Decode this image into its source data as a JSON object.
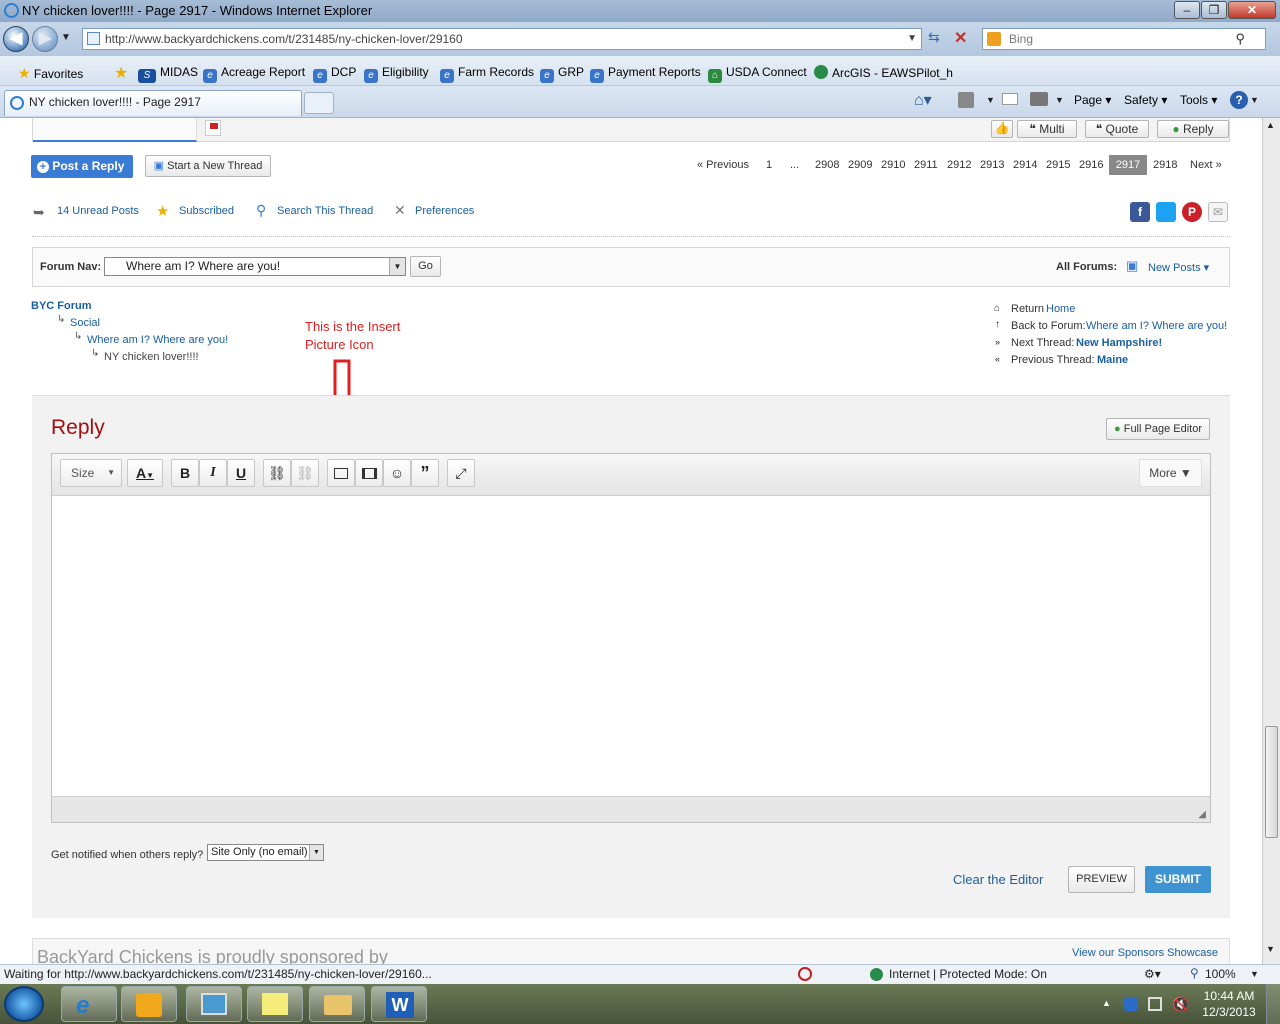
{
  "window": {
    "title": "NY chicken lover!!!! - Page 2917 - Windows Internet Explorer"
  },
  "address": {
    "url": "http://www.backyardchickens.com/t/231485/ny-chicken-lover/29160",
    "search_engine": "Bing"
  },
  "favorites": {
    "label": "Favorites",
    "items": [
      "MIDAS",
      "Acreage Report",
      "DCP",
      "Eligibility",
      "Farm Records",
      "GRP",
      "Payment Reports",
      "USDA Connect",
      "ArcGIS - EAWSPilot_h"
    ]
  },
  "tab": {
    "title": "NY chicken lover!!!! - Page 2917"
  },
  "commandbar": {
    "page": "Page",
    "safety": "Safety",
    "tools": "Tools"
  },
  "post_actions": {
    "multi": "Multi",
    "quote": "Quote",
    "reply": "Reply"
  },
  "thread_actions": {
    "post_reply": "Post a Reply",
    "new_thread": "Start a New Thread"
  },
  "pagination": {
    "previous": "« Previous",
    "first": "1",
    "ellipsis": "...",
    "pages": [
      "2908",
      "2909",
      "2910",
      "2911",
      "2912",
      "2913",
      "2914",
      "2915",
      "2916"
    ],
    "current": "2917",
    "after": "2918",
    "next": "Next »"
  },
  "tools_row": {
    "unread": "14 Unread Posts",
    "subscribed": "Subscribed",
    "search": "Search This Thread",
    "preferences": "Preferences"
  },
  "forum_nav": {
    "label": "Forum Nav:",
    "selected": "Where am I? Where are you!",
    "go": "Go",
    "all_forums": "All Forums:",
    "new_posts": "New Posts"
  },
  "breadcrumb": {
    "root": "BYC Forum",
    "level1": "Social",
    "level2": "Where am I? Where are you!",
    "level3": "NY chicken lover!!!!"
  },
  "annotation": {
    "line1": "This is the Insert",
    "line2": "Picture Icon",
    "color": "#e02020"
  },
  "thread_nav": {
    "return_label": "Return",
    "return_link": "Home",
    "back_label": "Back to Forum:",
    "back_link": "Where am I? Where are you!",
    "next_label": "Next Thread:",
    "next_link": "New Hampshire!",
    "prev_label": "Previous Thread:",
    "prev_link": "Maine"
  },
  "editor": {
    "heading": "Reply",
    "full_page": "Full Page Editor",
    "size": "Size",
    "more": "More"
  },
  "notify": {
    "label": "Get notified when others reply?",
    "selected": "Site Only (no email)"
  },
  "form_actions": {
    "clear": "Clear the Editor",
    "preview": "PREVIEW",
    "submit": "SUBMIT"
  },
  "footer": {
    "sponsor": "BackYard Chickens is proudly sponsored by",
    "showcase": "View our Sponsors Showcase"
  },
  "statusbar": {
    "text": "Waiting for http://www.backyardchickens.com/t/231485/ny-chicken-lover/29160...",
    "zone": "Internet | Protected Mode: On",
    "zoom": "100%"
  },
  "clock": {
    "time": "10:44 AM",
    "date": "12/3/2013"
  }
}
